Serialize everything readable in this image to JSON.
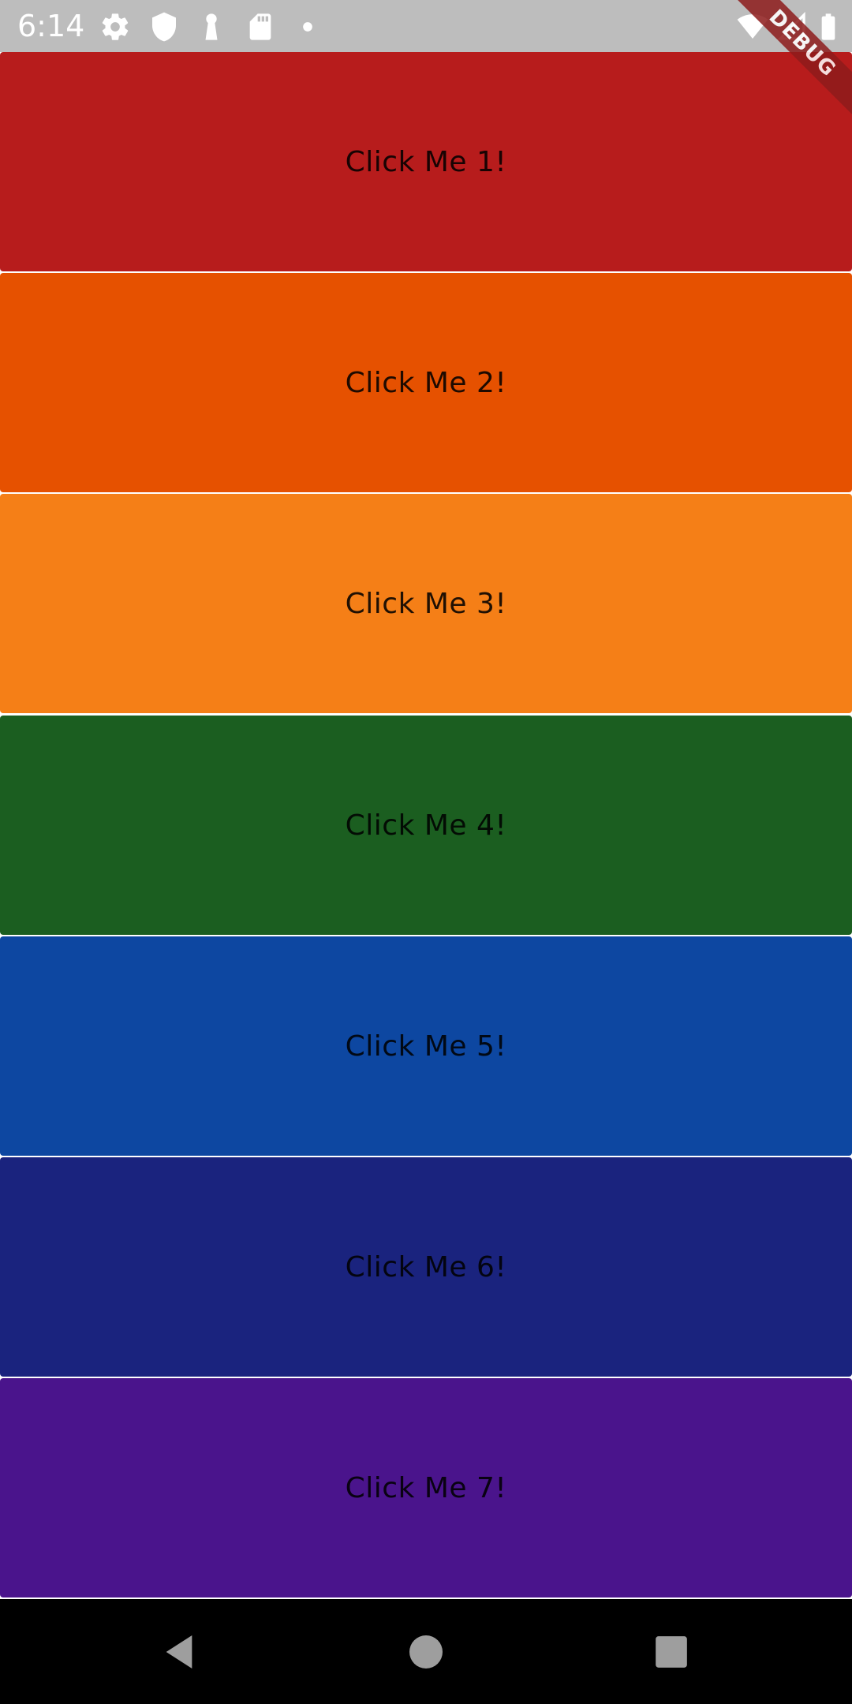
{
  "status_bar": {
    "time": "6:14",
    "left_icons": [
      "settings-icon",
      "shield-icon",
      "keyhole-icon",
      "sd-card-icon",
      "notification-dot-icon"
    ],
    "right_icons": [
      "wifi-icon",
      "cellular-signal-icon",
      "battery-icon"
    ]
  },
  "debug_banner": {
    "label": "DEBUG",
    "color": "#8e1b1b"
  },
  "buttons": [
    {
      "label": "Click Me 1!",
      "color": "#b71c1c"
    },
    {
      "label": "Click Me 2!",
      "color": "#e65100"
    },
    {
      "label": "Click Me 3!",
      "color": "#f57f17"
    },
    {
      "label": "Click Me 4!",
      "color": "#1b5e20"
    },
    {
      "label": "Click Me 5!",
      "color": "#0d47a1"
    },
    {
      "label": "Click Me 6!",
      "color": "#1a237e"
    },
    {
      "label": "Click Me 7!",
      "color": "#4a148c"
    }
  ],
  "nav_bar": {
    "buttons": [
      "back-icon",
      "home-icon",
      "recents-icon"
    ]
  }
}
